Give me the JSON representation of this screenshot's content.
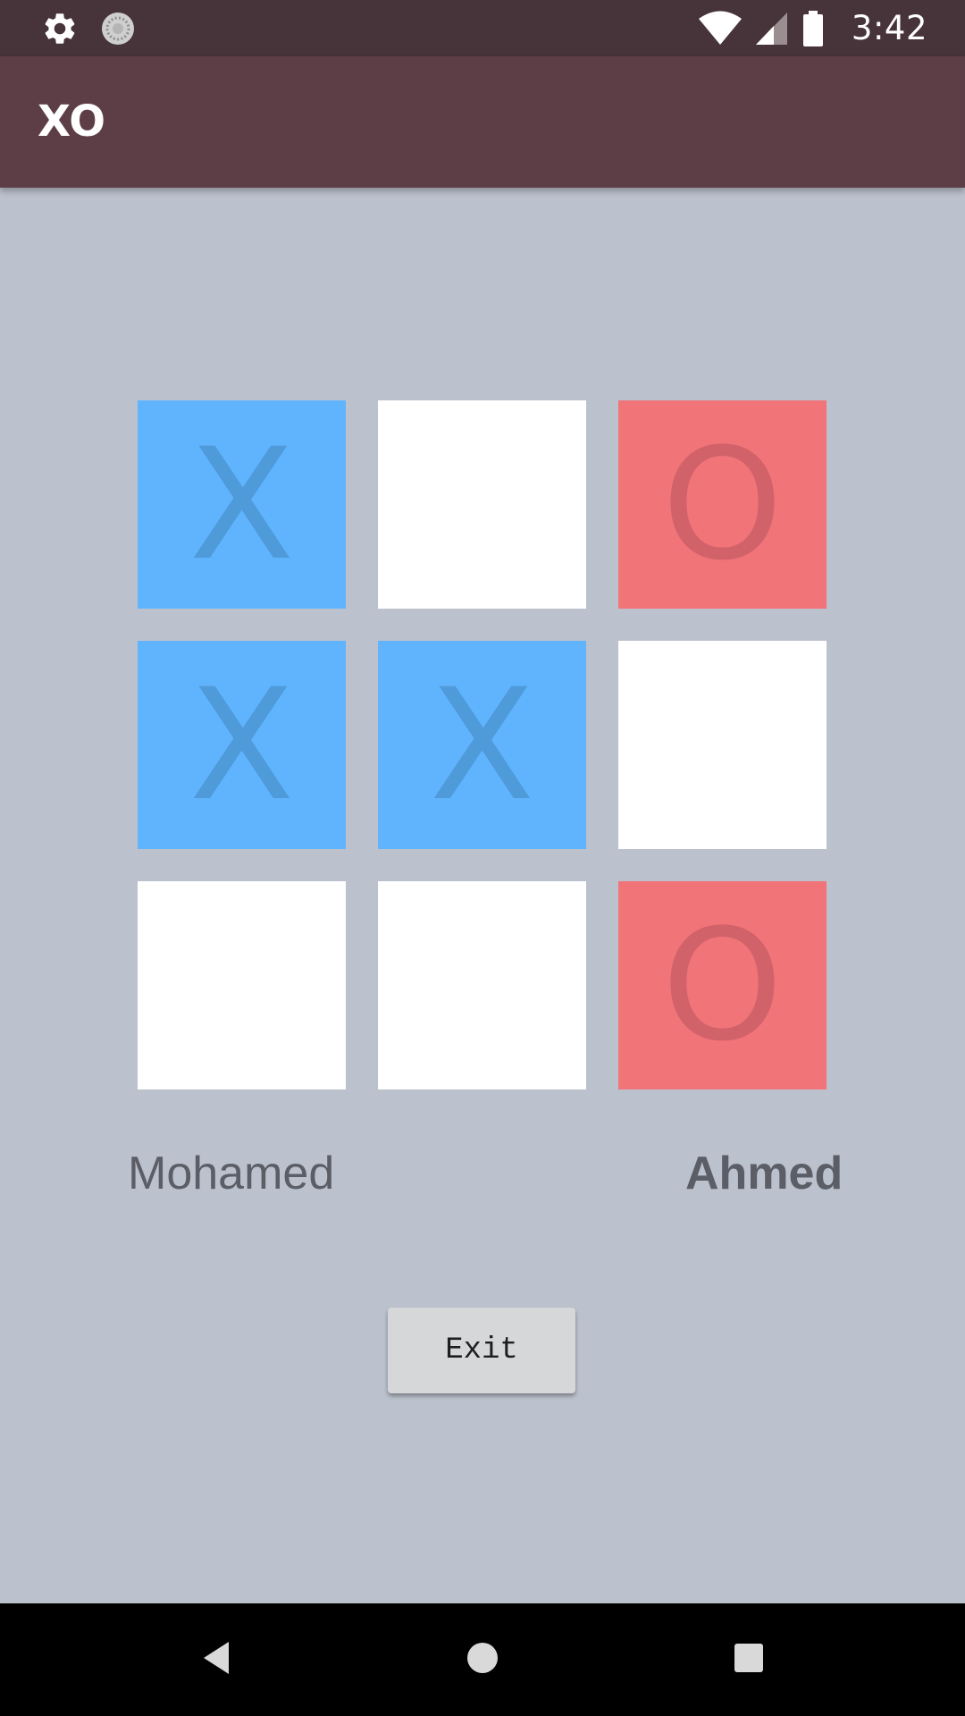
{
  "status_bar": {
    "time": "3:42",
    "icons": [
      "settings-icon",
      "sync-progress-icon",
      "wifi-icon",
      "cell-signal-icon",
      "battery-icon"
    ]
  },
  "app_bar": {
    "title": "XO"
  },
  "board": {
    "cells": [
      {
        "mark": "X",
        "state": "x"
      },
      {
        "mark": "",
        "state": "empty"
      },
      {
        "mark": "O",
        "state": "o"
      },
      {
        "mark": "X",
        "state": "x"
      },
      {
        "mark": "X",
        "state": "x"
      },
      {
        "mark": "",
        "state": "empty"
      },
      {
        "mark": "",
        "state": "empty"
      },
      {
        "mark": "",
        "state": "empty"
      },
      {
        "mark": "O",
        "state": "o"
      }
    ]
  },
  "players": {
    "player1": {
      "name": "Mohamed",
      "active": false
    },
    "player2": {
      "name": "Ahmed",
      "active": true
    }
  },
  "actions": {
    "exit_label": "Exit"
  },
  "nav_bar": {
    "icons": [
      "back-icon",
      "home-icon",
      "recents-icon"
    ]
  },
  "colors": {
    "status_bar": "#47333a",
    "app_bar": "#5d3e46",
    "background": "#bcc2cd",
    "x_cell": "#60b4fd",
    "x_mark": "#4f9ad9",
    "o_cell": "#f17479",
    "o_mark": "#d1626a",
    "empty_cell": "#ffffff"
  }
}
